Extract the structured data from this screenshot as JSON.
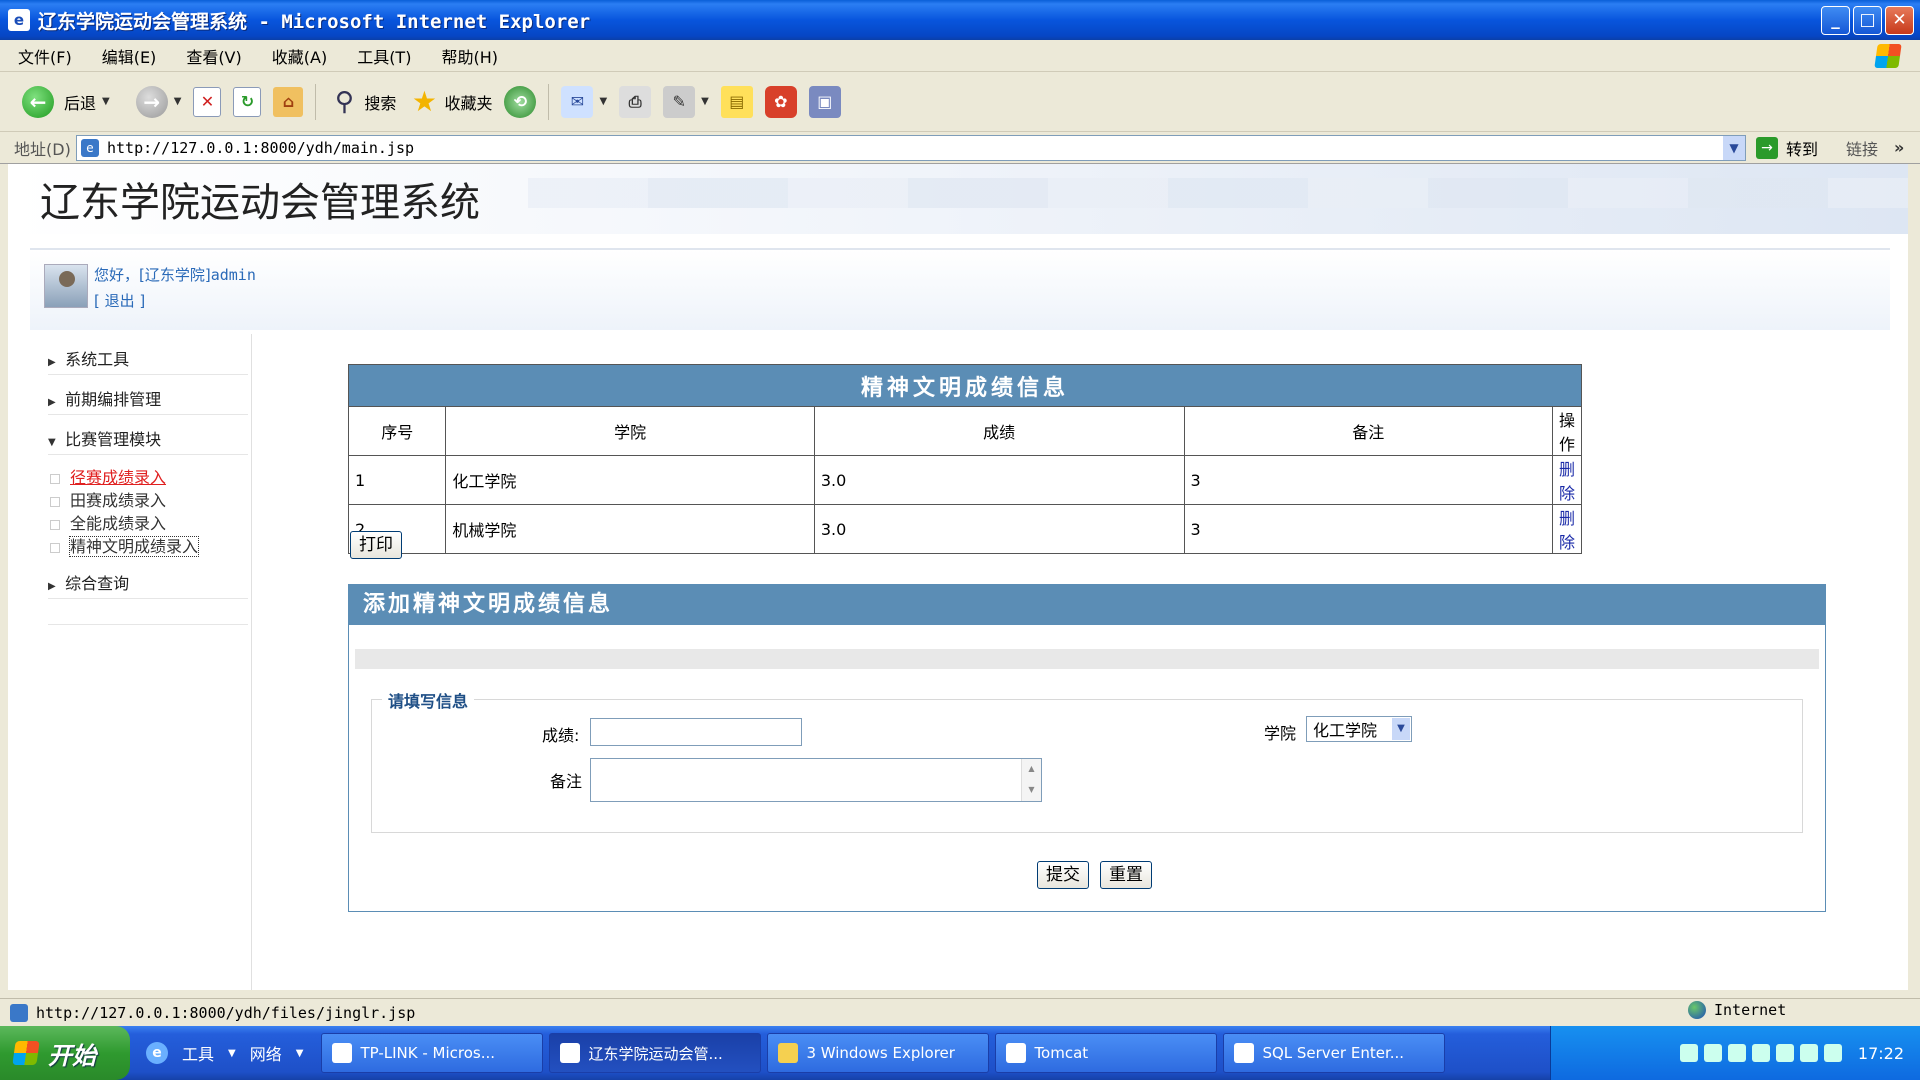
{
  "window": {
    "title": "辽东学院运动会管理系统 - Microsoft Internet Explorer"
  },
  "menu": [
    "文件(F)",
    "编辑(E)",
    "查看(V)",
    "收藏(A)",
    "工具(T)",
    "帮助(H)"
  ],
  "toolbar": {
    "back_label": "后退",
    "search_label": "搜索",
    "favorites_label": "收藏夹"
  },
  "address": {
    "label": "地址(D)",
    "url": "http://127.0.0.1:8000/ydh/main.jsp",
    "go_label": "转到",
    "links_label": "链接"
  },
  "site": {
    "title": "辽东学院运动会管理系统",
    "greeting": "您好，[辽东学院]",
    "username": "admin",
    "logout": "[ 退出 ]"
  },
  "sidebar": {
    "sections": [
      "系统工具",
      "前期编排管理",
      "比赛管理模块",
      "综合查询"
    ],
    "subitems": [
      "径赛成绩录入",
      "田赛成绩录入",
      "全能成绩录入",
      "精神文明成绩录入"
    ]
  },
  "result_table": {
    "caption": "精神文明成绩信息",
    "headers": [
      "序号",
      "学院",
      "成绩",
      "备注",
      "操作"
    ],
    "rows": [
      {
        "no": "1",
        "college": "化工学院",
        "score": "3.0",
        "note": "3",
        "action": "删除"
      },
      {
        "no": "2",
        "college": "机械学院",
        "score": "3.0",
        "note": "3",
        "action": "删除"
      }
    ],
    "print_label": "打印"
  },
  "add_form": {
    "title": "添加精神文明成绩信息",
    "legend": "请填写信息",
    "score_label": "成绩:",
    "score_value": "",
    "note_label": "备注",
    "note_value": "",
    "college_label": "学院",
    "college_selected": "化工学院",
    "submit_label": "提交",
    "reset_label": "重置"
  },
  "statusbar": {
    "url": "http://127.0.0.1:8000/ydh/files/jinglr.jsp",
    "zone": "Internet"
  },
  "taskbar": {
    "start_label": "开始",
    "quicklaunch": [
      "工具",
      "网络"
    ],
    "tasks": [
      "TP-LINK - Micros...",
      "辽东学院运动会管...",
      "3 Windows Explorer",
      "Tomcat",
      "SQL Server Enter..."
    ],
    "clock": "17:22"
  }
}
